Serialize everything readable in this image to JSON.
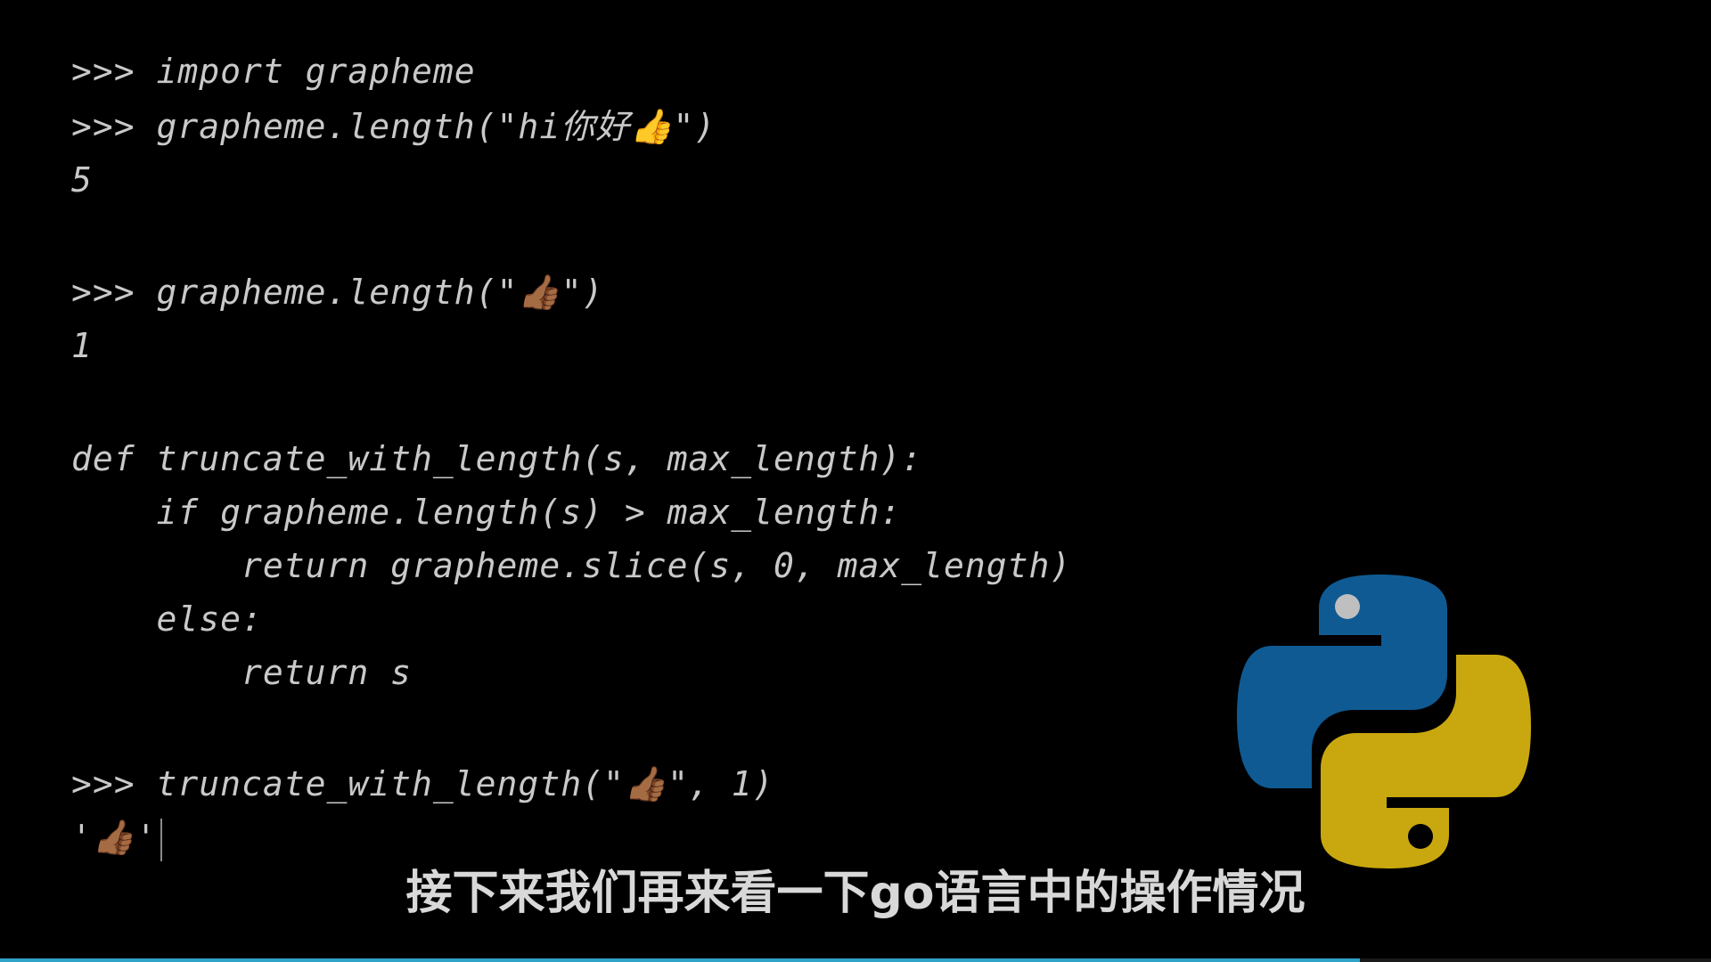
{
  "code": {
    "lines": [
      ">>> import grapheme",
      ">>> grapheme.length(\"hi你好👍\")",
      "5",
      "",
      ">>> grapheme.length(\"👍🏾\")",
      "1",
      "",
      "def truncate_with_length(s, max_length):",
      "    if grapheme.length(s) > max_length:",
      "        return grapheme.slice(s, 0, max_length)",
      "    else:",
      "        return s",
      "",
      ">>> truncate_with_length(\"👍🏾\", 1)",
      "'👍🏾'"
    ]
  },
  "subtitle": "接下来我们再来看一下go语言中的操作情况",
  "logo": {
    "name": "python-logo",
    "colors": {
      "blue": "#0f5a93",
      "yellow": "#c9a80f",
      "eye": "#bfbfbf"
    }
  },
  "progress": {
    "fraction": 0.795,
    "color": "#2fa3c8"
  }
}
